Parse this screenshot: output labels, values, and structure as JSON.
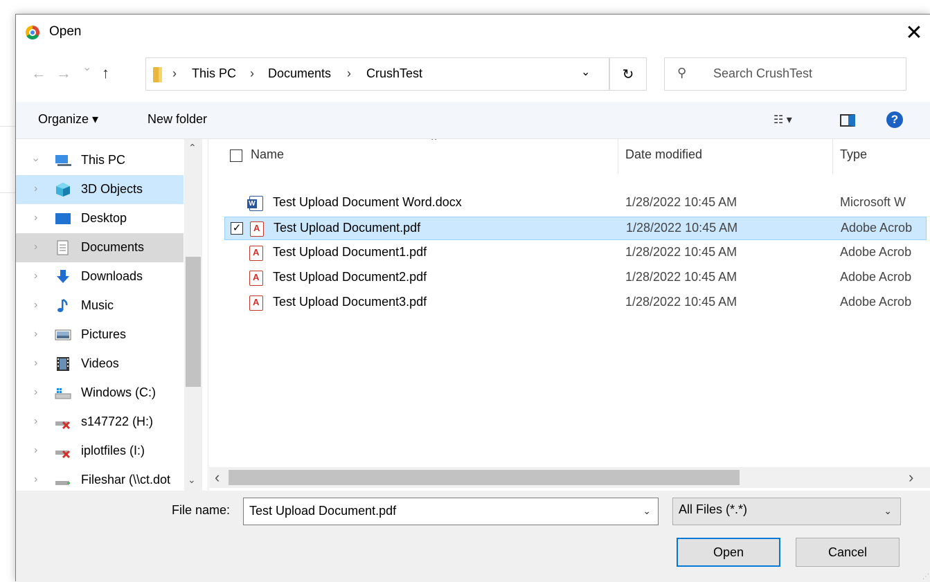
{
  "dialog": {
    "title": "Open",
    "close_glyph": "✕"
  },
  "address": {
    "nav_back": "←",
    "nav_forward": "→",
    "nav_recent": "⌄",
    "nav_up": "↑",
    "crumbs": [
      "This PC",
      "Documents",
      "CrushTest"
    ],
    "separator": "›",
    "dropdown_glyph": "⌄",
    "refresh_glyph": "↻",
    "search_placeholder": "Search CrushTest",
    "search_glyph": "⚲"
  },
  "toolbar": {
    "organize": "Organize ▾",
    "new_folder": "New folder",
    "view_glyph": "☷ ▾",
    "help": "?"
  },
  "navpane": {
    "items": [
      {
        "label": "This PC",
        "icon": "computer-icon"
      },
      {
        "label": "3D Objects",
        "icon": "cube-icon"
      },
      {
        "label": "Desktop",
        "icon": "desktop-icon"
      },
      {
        "label": "Documents",
        "icon": "documents-icon"
      },
      {
        "label": "Downloads",
        "icon": "download-icon"
      },
      {
        "label": "Music",
        "icon": "music-icon"
      },
      {
        "label": "Pictures",
        "icon": "pictures-icon"
      },
      {
        "label": "Videos",
        "icon": "videos-icon"
      },
      {
        "label": "Windows (C:)",
        "icon": "drive-icon"
      },
      {
        "label": "s147722 (H:)",
        "icon": "network-drive-disconnected-icon"
      },
      {
        "label": "iplotfiles (I:)",
        "icon": "network-drive-disconnected-icon"
      },
      {
        "label": "Fileshar (\\\\ct.dot",
        "icon": "network-drive-icon"
      }
    ],
    "scroll_up": "⌃",
    "scroll_down": "⌄"
  },
  "files": {
    "columns": {
      "name": "Name",
      "date": "Date modified",
      "type": "Type",
      "sort_caret": "⌃"
    },
    "rows": [
      {
        "name": "Test Upload Document Word.docx",
        "date": "1/28/2022 10:45 AM",
        "type": "Microsoft W",
        "icon": "word-icon"
      },
      {
        "name": "Test Upload Document.pdf",
        "date": "1/28/2022 10:45 AM",
        "type": "Adobe Acrob",
        "icon": "pdf-icon",
        "checked_glyph": "✓"
      },
      {
        "name": "Test Upload Document1.pdf",
        "date": "1/28/2022 10:45 AM",
        "type": "Adobe Acrob",
        "icon": "pdf-icon"
      },
      {
        "name": "Test Upload Document2.pdf",
        "date": "1/28/2022 10:45 AM",
        "type": "Adobe Acrob",
        "icon": "pdf-icon"
      },
      {
        "name": "Test Upload Document3.pdf",
        "date": "1/28/2022 10:45 AM",
        "type": "Adobe Acrob",
        "icon": "pdf-icon"
      }
    ],
    "hscroll_left": "‹",
    "hscroll_right": "›"
  },
  "footer": {
    "filename_label": "File name:",
    "filename_value": "Test Upload Document.pdf",
    "filename_dd": "⌄",
    "filetype_value": "All Files (*.*)",
    "filetype_dd": "⌄",
    "open_label": "Open",
    "cancel_label": "Cancel",
    "grip": "⋰"
  },
  "colors": {
    "selection": "#cce8ff",
    "accent": "#0078d7",
    "toolbar_bg": "#f3f6fb"
  }
}
